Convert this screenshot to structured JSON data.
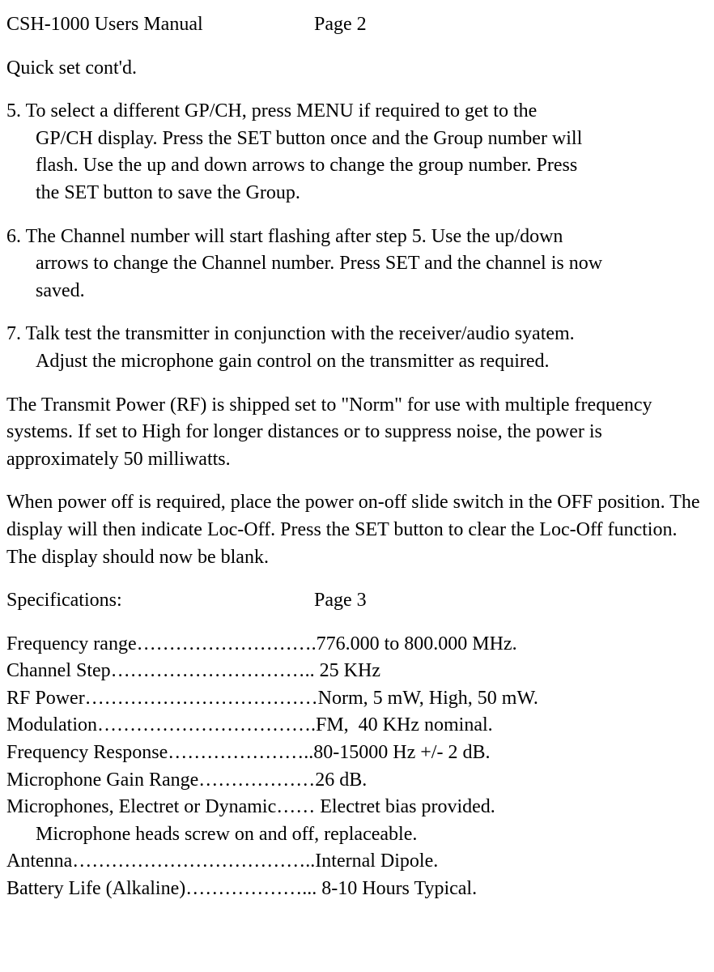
{
  "header": {
    "title": "CSH-1000 Users Manual",
    "page": "Page 2"
  },
  "section_heading": "Quick set cont'd.",
  "items": [
    {
      "num": "5.",
      "first": " To select a different GP/CH, press MENU if required to get to the",
      "cont": [
        "GP/CH display. Press the SET button once and the Group number will",
        "flash. Use the up and down arrows to change the group number. Press",
        "the SET button to save the Group."
      ]
    },
    {
      "num": "6.",
      "first": " The Channel number will start flashing after step 5. Use the up/down",
      "cont": [
        "arrows to change the Channel number. Press SET and the channel is now",
        "saved."
      ]
    },
    {
      "num": "7.",
      "first": " Talk test the transmitter in conjunction with the receiver/audio syatem.",
      "cont": [
        "Adjust the microphone gain control on the transmitter as required."
      ]
    }
  ],
  "paragraphs": [
    "The Transmit Power (RF) is shipped set to \"Norm\" for use with multiple frequency systems. If set to High for longer distances or to suppress noise, the power is approximately 50 milliwatts.",
    "When power off is required, place the power on-off slide switch in the OFF position. The display will then indicate Loc-Off. Press the SET button to clear the Loc-Off function. The display should now be blank."
  ],
  "specs_header": {
    "title": "Specifications:",
    "page": "Page 3"
  },
  "specs": [
    "Frequency range……………………….776.000 to 800.000 MHz.",
    "Channel Step………………………….. 25 KHz",
    "RF Power………………………………Norm, 5 mW, High, 50 mW.",
    "Modulation…………………………….FM,  40 KHz nominal.",
    "Frequency Response…………………..80-15000 Hz +/- 2 dB.",
    "Microphone Gain Range………………26 dB.",
    "Microphones, Electret or Dynamic…… Electret bias provided.",
    "Microphone heads screw on and off, replaceable.",
    "Antenna………………………………..Internal Dipole.",
    "Battery Life (Alkaline)………………... 8-10 Hours Typical."
  ]
}
